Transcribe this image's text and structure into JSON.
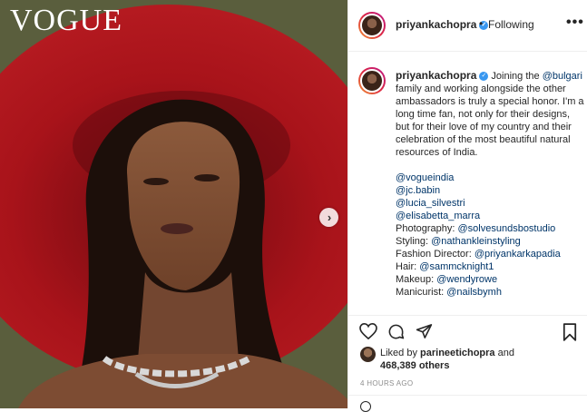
{
  "image": {
    "magazine_logo": "VOGUE",
    "next_icon": "chevron-right-icon"
  },
  "header": {
    "username": "priyankachopra",
    "verified_icon": "verified-badge-icon",
    "separator": "•",
    "follow_status": "Following",
    "more_icon": "ellipsis-icon",
    "more_label": "•••"
  },
  "caption": {
    "username": "priyankachopra",
    "intro_before": " Joining the ",
    "mention_brand": "@bulgari",
    "intro_after": " family and working alongside the other ambassadors is truly a special honor. I'm a long time fan, not only for their designs, but for their love of my country and their celebration of the most beautiful natural resources of India.",
    "mentions": [
      "@vogueindia",
      "@jc.babin",
      "@lucia_silvestri",
      "@elisabetta_marra"
    ],
    "credits": [
      {
        "label": "Photography: ",
        "handle": "@solvesundsbostudio"
      },
      {
        "label": "Styling: ",
        "handle": "@nathankleinstyling"
      },
      {
        "label": "Fashion Director: ",
        "handle": "@priyankarkapadia"
      },
      {
        "label": "Hair: ",
        "handle": "@sammcknight1"
      },
      {
        "label": "Makeup: ",
        "handle": "@wendyrowe"
      },
      {
        "label": "Manicurist: ",
        "handle": "@nailsbymh"
      }
    ]
  },
  "actions": {
    "like_icon": "heart-icon",
    "comment_icon": "comment-icon",
    "share_icon": "share-icon",
    "save_icon": "bookmark-icon"
  },
  "likes": {
    "prefix": "Liked by ",
    "user": "parineetichopra",
    "middle": " and",
    "count": "468,389 others"
  },
  "timestamp": "4 HOURS AGO",
  "footer": {
    "emoji_icon": "smiley-icon"
  },
  "colors": {
    "link": "#003569",
    "verified": "#3897f0",
    "muted": "#8e8e8e",
    "hat_red": "#a8131a"
  }
}
